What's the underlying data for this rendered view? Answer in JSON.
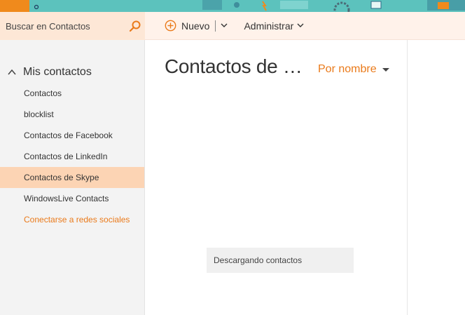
{
  "search": {
    "placeholder": "Buscar en Contactos"
  },
  "commands": {
    "new_label": "Nuevo",
    "manage_label": "Administrar"
  },
  "sidebar": {
    "group_title": "Mis contactos",
    "items": [
      {
        "label": "Contactos"
      },
      {
        "label": "blocklist"
      },
      {
        "label": "Contactos de Facebook"
      },
      {
        "label": "Contactos de LinkedIn"
      },
      {
        "label": "Contactos de Skype",
        "selected": true
      },
      {
        "label": "WindowsLive Contacts"
      }
    ],
    "social_link": "Conectarse a redes sociales"
  },
  "list": {
    "title": "Contactos de Sk...",
    "sort_label": "Por nombre",
    "status": "Descargando contactos"
  },
  "colors": {
    "accent": "#ea7a1a",
    "banner": "#5cc2bd",
    "selected": "#fcd4b4",
    "commandbar": "#fff2ea",
    "search": "#fde7d6"
  }
}
